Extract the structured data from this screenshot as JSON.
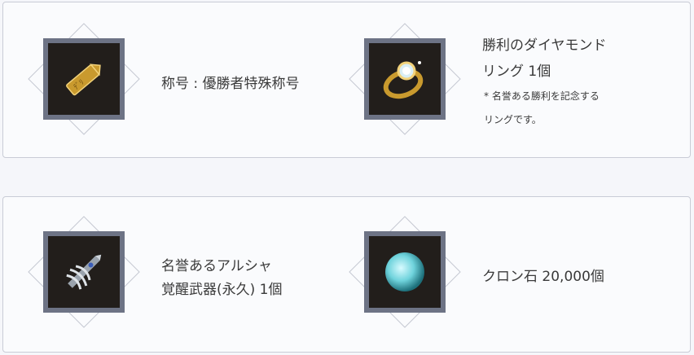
{
  "rewards": {
    "title_reward": {
      "label": "称号 : 優勝者特殊称号",
      "icon": "gold-tag-icon"
    },
    "ring_reward": {
      "label_line1": "勝利のダイヤモンド",
      "label_line2": "リング 1個",
      "note_line1": "* 名誉ある勝利を記念する",
      "note_line2": "リングです。",
      "icon": "diamond-ring-icon"
    },
    "weapon_reward": {
      "label_line1": "名誉あるアルシャ",
      "label_line2": "覚醒武器(永久) 1個",
      "icon": "awakening-weapon-icon"
    },
    "stone_reward": {
      "label": "クロン石 20,000個",
      "icon": "cron-stone-icon"
    }
  },
  "colors": {
    "frame": "#6d7385",
    "icon_bg": "#221e1b",
    "card_border": "#c9ccd6",
    "gold": "#c99a2e",
    "cyan": "#6fd3dc"
  }
}
